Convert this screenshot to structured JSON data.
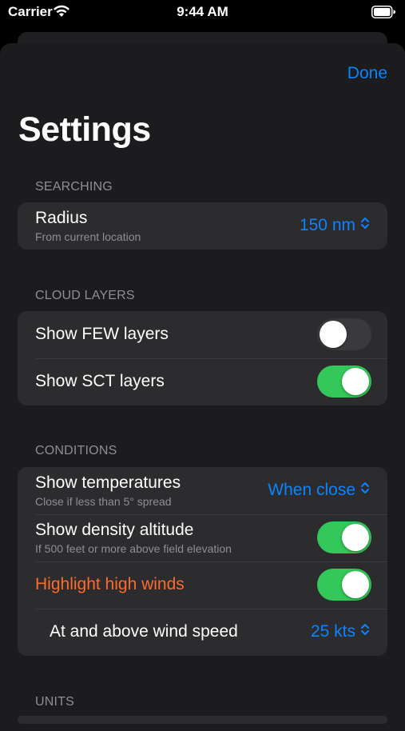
{
  "status": {
    "carrier": "Carrier",
    "time": "9:44 AM"
  },
  "nav": {
    "done_label": "Done"
  },
  "title": "Settings",
  "searching": {
    "header": "SEARCHING",
    "radius_label": "Radius",
    "radius_sub": "From current location",
    "radius_value": "150 nm"
  },
  "cloud_layers": {
    "header": "CLOUD LAYERS",
    "few_label": "Show FEW layers",
    "few_on": false,
    "sct_label": "Show SCT layers",
    "sct_on": true
  },
  "conditions": {
    "header": "CONDITIONS",
    "temps_label": "Show temperatures",
    "temps_sub": "Close if less than 5° spread",
    "temps_value": "When close",
    "density_label": "Show density altitude",
    "density_sub": "If 500 feet or more above field elevation",
    "density_on": true,
    "winds_label": "Highlight high winds",
    "winds_on": true,
    "wind_speed_label": "At and above wind speed",
    "wind_speed_value": "25 kts"
  },
  "units": {
    "header": "UNITS"
  },
  "colors": {
    "accent": "#0a84ff",
    "toggle_on": "#34c759",
    "warning": "#ff6a2b"
  }
}
